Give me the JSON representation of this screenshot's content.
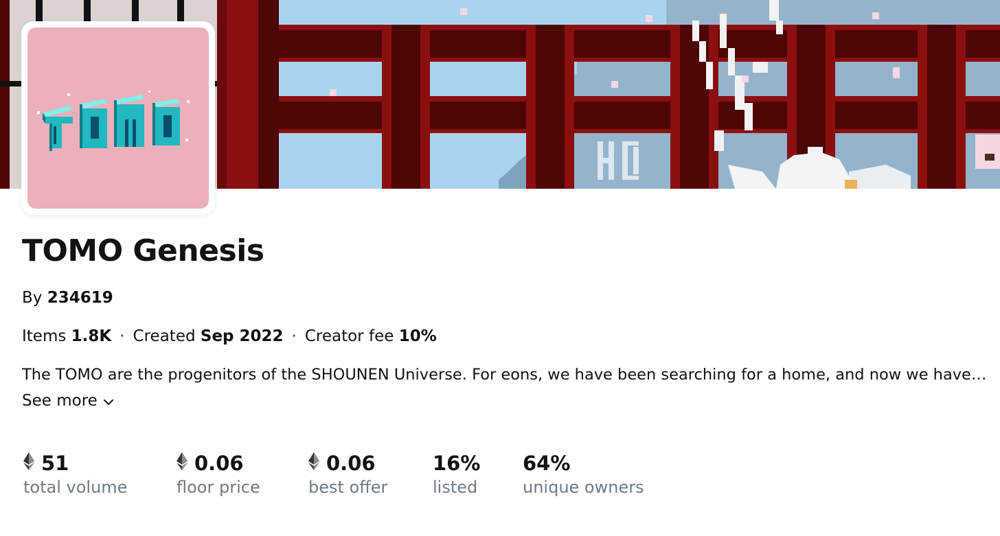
{
  "collection": {
    "name": "TOMO Genesis",
    "by_prefix": "By",
    "creator": "234619",
    "items_label": "Items",
    "items_value": "1.8K",
    "created_label": "Created",
    "created_value": "Sep 2022",
    "fee_label": "Creator fee",
    "fee_value": "10%",
    "separator": "·",
    "description": "The TOMO are the progenitors of the SHOUNEN Universe. For eons, we have been searching for a home, and now we have found it...",
    "see_more": "See more"
  },
  "avatar": {
    "logo_text": "TOMO",
    "background": "#ecb0ba",
    "accent": "#2ec4c4"
  },
  "stats": [
    {
      "value": "51",
      "label": "total volume",
      "icon": "eth-icon"
    },
    {
      "value": "0.06",
      "label": "floor price",
      "icon": "eth-icon"
    },
    {
      "value": "0.06",
      "label": "best offer",
      "icon": "eth-icon"
    },
    {
      "value": "16%",
      "label": "listed",
      "icon": ""
    },
    {
      "value": "64%",
      "label": "unique owners",
      "icon": ""
    }
  ],
  "colors": {
    "text": "#121212",
    "muted": "#707a83",
    "banner_red": "#8c0f0f",
    "banner_dark": "#4d0506",
    "banner_sky": "#a9d4f0"
  }
}
